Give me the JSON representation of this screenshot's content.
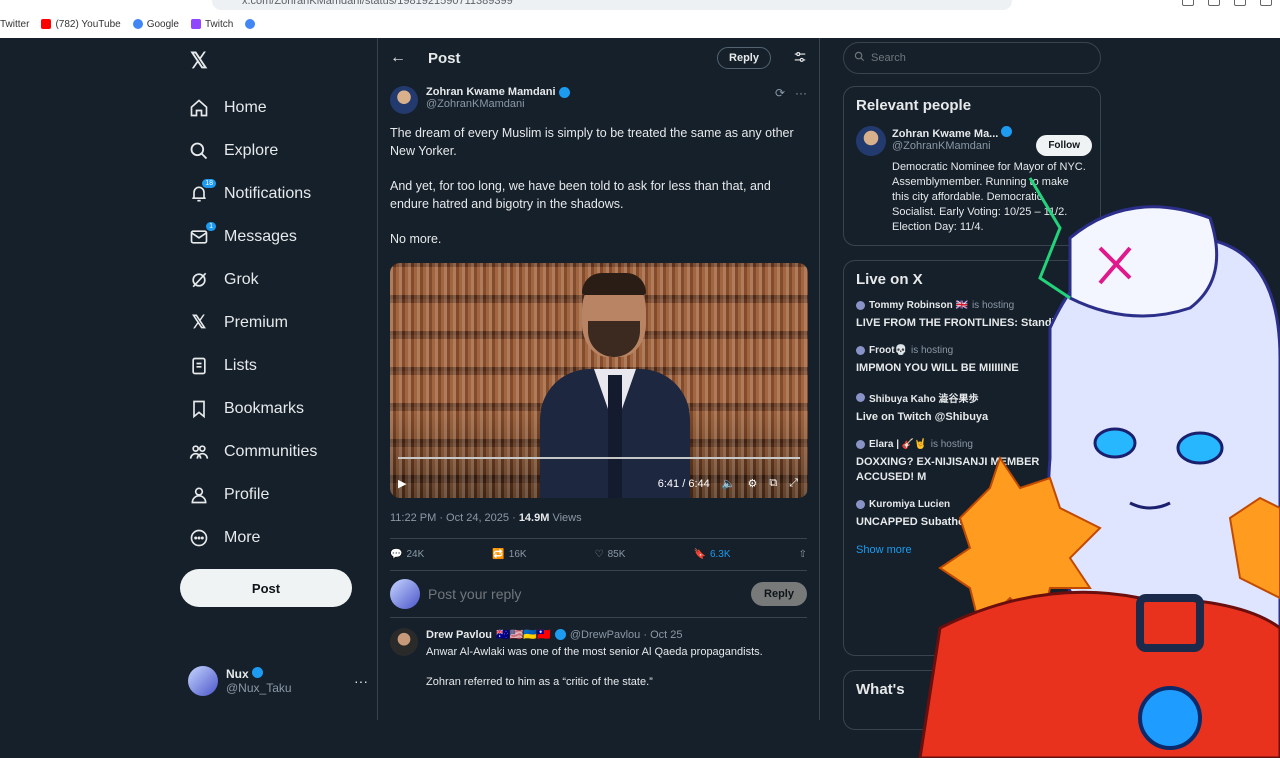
{
  "browser": {
    "url": "x.com/ZohranKMamdani/status/1981921590711389399",
    "bookmarks": [
      {
        "label": "Twitter",
        "color": "#1da1f2"
      },
      {
        "label": "(782) YouTube",
        "color": "#ff0000"
      },
      {
        "label": "Google",
        "color": "#4285f4"
      },
      {
        "label": "Twitch",
        "color": "#9146ff"
      },
      {
        "label": "",
        "color": "#4285f4"
      }
    ]
  },
  "nav": {
    "logo": "𝕏",
    "items": [
      {
        "label": "Home",
        "icon": "home-icon",
        "badge": ""
      },
      {
        "label": "Explore",
        "icon": "search-icon",
        "badge": ""
      },
      {
        "label": "Notifications",
        "icon": "bell-icon",
        "badge": "18"
      },
      {
        "label": "Messages",
        "icon": "mail-icon",
        "badge": "1"
      },
      {
        "label": "Grok",
        "icon": "grok-icon",
        "badge": ""
      },
      {
        "label": "Premium",
        "icon": "x-logo-icon",
        "badge": ""
      },
      {
        "label": "Lists",
        "icon": "list-icon",
        "badge": ""
      },
      {
        "label": "Bookmarks",
        "icon": "bookmark-icon",
        "badge": ""
      },
      {
        "label": "Communities",
        "icon": "communities-icon",
        "badge": ""
      },
      {
        "label": "Profile",
        "icon": "person-icon",
        "badge": ""
      },
      {
        "label": "More",
        "icon": "more-circle-icon",
        "badge": ""
      }
    ],
    "post_label": "Post",
    "account": {
      "name": "Nux",
      "handle": "@Nux_Taku",
      "menu": "···"
    }
  },
  "header": {
    "back": "←",
    "title": "Post",
    "reply_label": "Reply"
  },
  "tweet": {
    "name": "Zohran Kwame Mamdani",
    "handle": "@ZohranKMamdani",
    "paragraphs": [
      "The dream of every Muslim is simply to be treated the same as any other New Yorker.",
      "And yet, for too long, we have been told to ask for less than that, and endure hatred and bigotry in the shadows.",
      "No more."
    ],
    "video": {
      "time": "6:41 / 6:44",
      "progress": 0.99
    },
    "timestamp": "11:22 PM · Oct 24, 2025 · ",
    "views": "14.9M",
    "views_label": " Views",
    "stats": {
      "replies": "24K",
      "reposts": "16K",
      "likes": "85K",
      "bookmarks": "6.3K"
    }
  },
  "reply_box": {
    "placeholder": "Post your reply",
    "button": "Reply"
  },
  "reply": {
    "name": "Drew Pavlou",
    "flags": "🇦🇺🇺🇸🇺🇦🇹🇼",
    "handle": "@DrewPavlou · Oct 25",
    "lines": [
      "Anwar Al-Awlaki was one of the most senior Al Qaeda propagandists.",
      "Zohran referred to him as a “critic of the state.”"
    ]
  },
  "right": {
    "search_placeholder": "Search",
    "relevant": {
      "title": "Relevant people",
      "name": "Zohran Kwame Ma...",
      "handle": "@ZohranKMamdani",
      "follow": "Follow",
      "bio": "Democratic Nominee for Mayor of NYC. Assemblymember. Running to make this city affordable. Democratic Socialist. Early Voting: 10/25 – 11/2. Election Day: 11/4."
    },
    "live": {
      "title": "Live on X",
      "items": [
        {
          "host": "Tommy Robinson 🇬🇧",
          "status": "is hosting",
          "title": "LIVE FROM THE FRONTLINES: Standing ..."
        },
        {
          "host": "Froot💀",
          "status": "is hosting",
          "title": "IMPMON YOU WILL BE  MIIIIINE"
        },
        {
          "host": "Shibuya Kaho 澁谷果歩",
          "status": "",
          "title": "Live on Twitch @Shibuya"
        },
        {
          "host": "Elara | 🎸🤘",
          "status": "is hosting",
          "title": "DOXXING? EX-NIJISANJI MEMBER ACCUSED! M"
        },
        {
          "host": "Kuromiya Lucien",
          "status": "",
          "title": "UNCAPPED Subathon 38 ✦ Final Day?"
        }
      ],
      "show_more": "Show more"
    },
    "whats": "What's"
  }
}
